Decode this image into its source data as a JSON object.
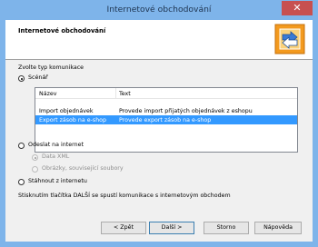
{
  "window": {
    "title": "Internetové obchodování",
    "close_glyph": "✕"
  },
  "header": {
    "title": "Internetové obchodování",
    "logo_icon": "internet-shop-icon"
  },
  "section_label": "Zvolte typ komunikace",
  "options": {
    "scenario": "Scénář",
    "send": "Odeslat na internet",
    "data_xml": "Data XML",
    "images": "Obrázky, související soubory",
    "download": "Stáhnout z internetu"
  },
  "listview": {
    "columns": [
      "Název",
      "Text"
    ],
    "rows": [
      {
        "name": "Import objednávek",
        "text": "Provede import přijatých objednávek z eshopu",
        "selected": false
      },
      {
        "name": "Export zásob na e-shop",
        "text": "Provede export zásob na e-shop",
        "selected": true
      }
    ]
  },
  "info_text": "Stisknutím tlačítka DALŠÍ se spustí komunikace s internetovým obchodem",
  "buttons": {
    "back": "< Zpět",
    "next": "Další >",
    "cancel": "Storno",
    "help": "Nápověda"
  }
}
